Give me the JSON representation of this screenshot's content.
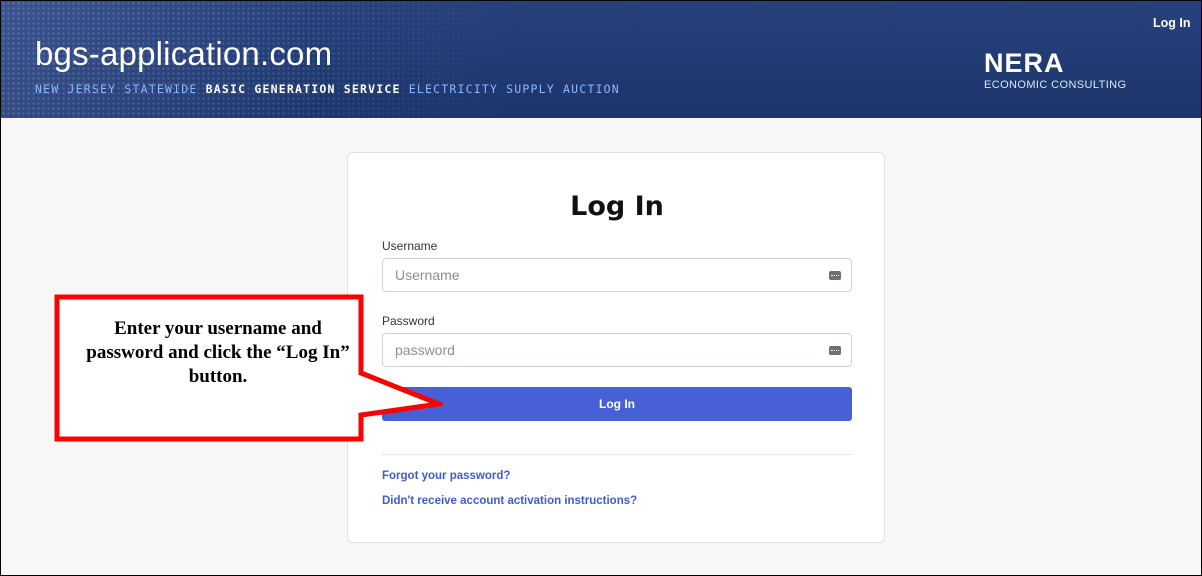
{
  "header": {
    "site_title": "bgs-application.com",
    "subtitle_part1": "New Jersey Statewide ",
    "subtitle_part2": "Basic Generation Service",
    "subtitle_part3": " Electricity Supply Auction",
    "logo_name": "NERA",
    "logo_tagline": "ECONOMIC CONSULTING",
    "login_link": "Log In"
  },
  "form": {
    "title": "Log In",
    "username_label": "Username",
    "username_placeholder": "Username",
    "username_value": "",
    "password_label": "Password",
    "password_placeholder": "password",
    "password_value": "",
    "submit_label": "Log In",
    "forgot_link": "Forgot your password?",
    "activation_link": "Didn't receive account activation instructions?"
  },
  "annotation": {
    "text": "Enter your username and password and click the “Log In” button."
  },
  "colors": {
    "banner": "#23407a",
    "button": "#4760d6",
    "link": "#3f5ccd",
    "callout_border": "#ff0000"
  },
  "icons": {
    "username_field": "password-manager-key-icon",
    "password_field": "password-manager-key-icon"
  }
}
